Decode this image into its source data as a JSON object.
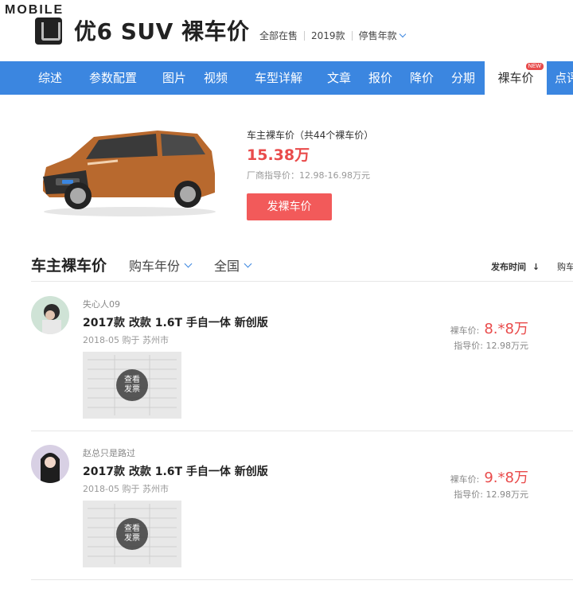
{
  "watermark": "MOBILE",
  "header": {
    "model_title": "优6 SUV  裸车价",
    "filters": [
      "全部在售",
      "2019款",
      "停售年款"
    ]
  },
  "nav": {
    "items": [
      "综述",
      "参数配置",
      "图片",
      "视频",
      "车型详解",
      "文章",
      "报价",
      "降价",
      "分期",
      "裸车价",
      "点评"
    ],
    "active_index": 9,
    "badge": "NEW"
  },
  "summary": {
    "label": "车主裸车价（共44个裸车价）",
    "price": "15.38万",
    "guide": "厂商指导价：12.98-16.98万元",
    "button": "发裸车价"
  },
  "section": {
    "title": "车主裸车价",
    "filter_year": "购车年份",
    "filter_region": "全国",
    "sort_time": "发布时间",
    "sort_buy": "购车"
  },
  "entries": [
    {
      "user": "失心人09",
      "model": "2017款 改款 1.6T 手自一体 新创版",
      "buy_info": "2018-05 购于 苏州市",
      "invoice_label_1": "查看",
      "invoice_label_2": "发票",
      "deal_label": "裸车价:",
      "deal_price": "8.*8万",
      "guide": "指导价:  12.98万元"
    },
    {
      "user": "赵总只是路过",
      "model": "2017款 改款 1.6T 手自一体 新创版",
      "buy_info": "2018-05 购于 苏州市",
      "invoice_label_1": "查看",
      "invoice_label_2": "发票",
      "deal_label": "裸车价:",
      "deal_price": "9.*8万",
      "guide": "指导价:  12.98万元"
    }
  ],
  "colors": {
    "nav_bg": "#3b86e0",
    "price_red": "#e94b4b",
    "button_red": "#f25a5a",
    "car_body": "#b8692e"
  }
}
